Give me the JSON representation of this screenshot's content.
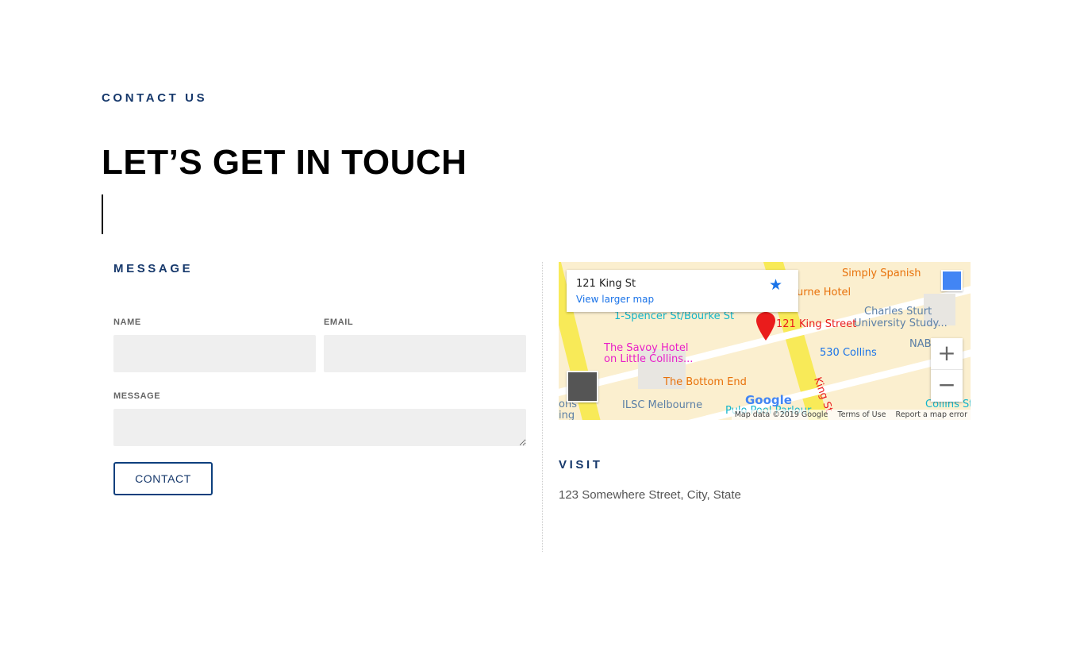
{
  "header": {
    "eyebrow": "CONTACT US",
    "title": "LET’S GET IN TOUCH"
  },
  "form": {
    "section_title": "MESSAGE",
    "name_label": "NAME",
    "name_value": "",
    "email_label": "EMAIL",
    "email_value": "",
    "message_label": "MESSAGE",
    "message_value": "",
    "submit_label": "CONTACT"
  },
  "map": {
    "place_name": "121 King St",
    "view_larger": "View larger map",
    "marker_label": "121 King Street",
    "labels": [
      "Simply Spanish",
      "urne Hotel",
      "1-Spencer St/Bourke St",
      "Charles Sturt",
      "University Study...",
      "The Savoy Hotel",
      "on Little Collins...",
      "530 Collins",
      "NAB",
      "The Bottom End",
      "King St",
      "ILSC Melbourne",
      "Pulo Pool Parlour",
      "Collins St",
      "ons",
      "ing"
    ],
    "google_logo": "Google",
    "attribution": [
      "Map data ©2019 Google",
      "Terms of Use",
      "Report a map error"
    ],
    "zoom_in": "+",
    "zoom_out": "−",
    "colors": {
      "road": "#f8ea58",
      "land": "#fbefcf",
      "marker": "#ea1c1c",
      "link": "#1a73e8"
    }
  },
  "visit": {
    "title": "VISIT",
    "address": "123 Somewhere Street, City, State"
  },
  "colors": {
    "accent": "#16386b",
    "input_bg": "#efefef"
  }
}
